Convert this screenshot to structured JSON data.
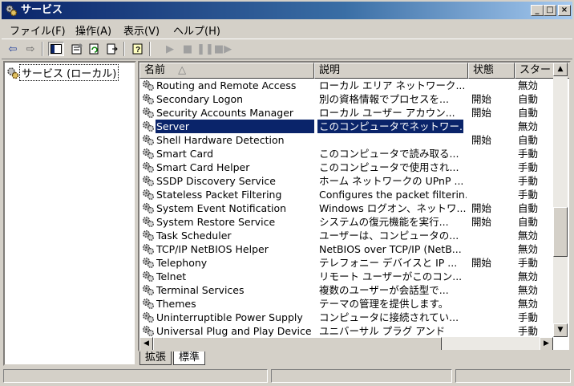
{
  "window": {
    "title": "サービス"
  },
  "menu": [
    "ファイル(F)",
    "操作(A)",
    "表示(V)",
    "ヘルプ(H)"
  ],
  "tree": {
    "root": "サービス (ローカル)"
  },
  "columns": {
    "name": "名前",
    "desc": "説明",
    "status": "状態",
    "startup": "スタート"
  },
  "sort_indicator": "△",
  "rows": [
    {
      "name": "Routing and Remote Access",
      "desc": "ローカル エリア ネットワーク...",
      "status": "",
      "startup": "無効"
    },
    {
      "name": "Secondary Logon",
      "desc": "別の資格情報でプロセスを...",
      "status": "開始",
      "startup": "自動"
    },
    {
      "name": "Security Accounts Manager",
      "desc": "ローカル ユーザー アカウン...",
      "status": "開始",
      "startup": "自動"
    },
    {
      "name": "Server",
      "desc": "このコンピュータでネットワー...",
      "status": "",
      "startup": "無効",
      "selected": true
    },
    {
      "name": "Shell Hardware Detection",
      "desc": "",
      "status": "開始",
      "startup": "自動"
    },
    {
      "name": "Smart Card",
      "desc": "このコンピュータで読み取る...",
      "status": "",
      "startup": "手動"
    },
    {
      "name": "Smart Card Helper",
      "desc": "このコンピュータで使用され...",
      "status": "",
      "startup": "手動"
    },
    {
      "name": "SSDP Discovery Service",
      "desc": "ホーム ネットワークの UPnP ...",
      "status": "",
      "startup": "手動"
    },
    {
      "name": "Stateless Packet Filtering",
      "desc": "Configures the packet filterin...",
      "status": "",
      "startup": "手動"
    },
    {
      "name": "System Event Notification",
      "desc": "Windows ログオン、ネットワ...",
      "status": "開始",
      "startup": "自動"
    },
    {
      "name": "System Restore Service",
      "desc": "システムの復元機能を実行...",
      "status": "開始",
      "startup": "自動"
    },
    {
      "name": "Task Scheduler",
      "desc": "ユーザーは、コンピュータの...",
      "status": "",
      "startup": "無効"
    },
    {
      "name": "TCP/IP NetBIOS Helper",
      "desc": "NetBIOS over TCP/IP (NetB...",
      "status": "",
      "startup": "無効"
    },
    {
      "name": "Telephony",
      "desc": "テレフォニー デバイスと IP ...",
      "status": "開始",
      "startup": "手動"
    },
    {
      "name": "Telnet",
      "desc": "リモート ユーザーがこのコン...",
      "status": "",
      "startup": "無効"
    },
    {
      "name": "Terminal Services",
      "desc": "複数のユーザーが会話型で...",
      "status": "",
      "startup": "無効"
    },
    {
      "name": "Themes",
      "desc": "テーマの管理を提供します。",
      "status": "",
      "startup": "無効"
    },
    {
      "name": "Uninterruptible Power Supply",
      "desc": "コンピュータに接続されてい...",
      "status": "",
      "startup": "手動"
    },
    {
      "name": "Universal Plug and Play Device",
      "desc": "ユニバーサル プラグ アンド",
      "status": "",
      "startup": "手動"
    }
  ],
  "tabs": [
    "拡張",
    "標準"
  ],
  "active_tab": "標準",
  "colors": {
    "title_start": "#0a246a",
    "title_end": "#a6caf0",
    "selection": "#0a246a",
    "face": "#d4d0c8"
  },
  "icons": {
    "app": "services-gear-icon",
    "row": "service-gear-icon"
  }
}
